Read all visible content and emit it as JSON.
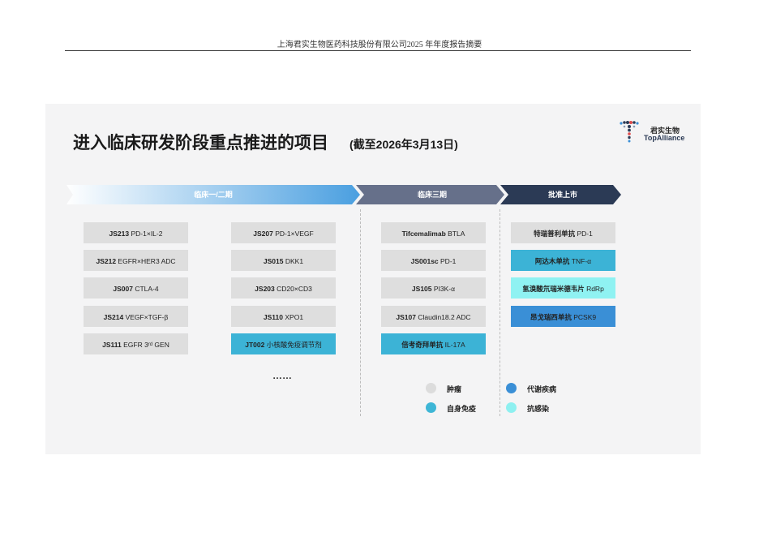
{
  "page_header": "上海君实生物医药科技股份有限公司2025 年年度报告摘要",
  "slide": {
    "title": "进入临床研发阶段重点推进的项目",
    "subtitle": "(截至2026年3月13日)",
    "logo": {
      "cn": "君实生物",
      "en": "TopAlliance"
    }
  },
  "phases": [
    {
      "label": "临床一/二期",
      "color": "#4a9fe0"
    },
    {
      "label": "临床三期",
      "color": "#66708a"
    },
    {
      "label": "批准上市",
      "color": "#2b3a55"
    }
  ],
  "columns": [
    {
      "items": [
        {
          "code": "JS213",
          "rest": " PD-1×IL-2",
          "category": "oncology"
        },
        {
          "code": "JS212",
          "rest": " EGFR×HER3 ADC",
          "category": "oncology"
        },
        {
          "code": "JS007",
          "rest": " CTLA-4",
          "category": "oncology"
        },
        {
          "code": "JS214",
          "rest": " VEGF×TGF-β",
          "category": "oncology"
        },
        {
          "code": "JS111",
          "rest": " EGFR 3ʳᵈ GEN",
          "category": "oncology"
        }
      ]
    },
    {
      "items": [
        {
          "code": "JS207",
          "rest": " PD-1×VEGF",
          "category": "oncology"
        },
        {
          "code": "JS015",
          "rest": " DKK1",
          "category": "oncology"
        },
        {
          "code": "JS203",
          "rest": " CD20×CD3",
          "category": "oncology"
        },
        {
          "code": "JS110",
          "rest": " XPO1",
          "category": "oncology"
        },
        {
          "code": "JT002",
          "rest": " 小核酸免疫调节剂",
          "category": "autoimmune"
        }
      ]
    },
    {
      "items": [
        {
          "code": "Tifcemalimab",
          "rest": " BTLA",
          "category": "oncology"
        },
        {
          "code": "JS001sc",
          "rest": " PD-1",
          "category": "oncology"
        },
        {
          "code": "JS105",
          "rest": " PI3K-α",
          "category": "oncology"
        },
        {
          "code": "JS107",
          "rest": " Claudin18.2 ADC",
          "category": "oncology"
        },
        {
          "code": "倍考奇拜单抗",
          "rest": " IL-17A",
          "category": "autoimmune"
        }
      ]
    },
    {
      "items": [
        {
          "code": "特瑞普利单抗",
          "rest": " PD-1",
          "category": "oncology"
        },
        {
          "code": "阿达木单抗",
          "rest": " TNF-α",
          "category": "autoimmune"
        },
        {
          "code": "氢溴酸氘瑞米德韦片",
          "rest": "  RdRp",
          "category": "anti_infection"
        },
        {
          "code": "昂戈瑞西单抗",
          "rest": " PCSK9",
          "category": "metabolic"
        }
      ]
    }
  ],
  "ellipsis": "……",
  "legend": [
    {
      "key": "oncology",
      "label": "肿瘤",
      "color": "#dcdcdc"
    },
    {
      "key": "metabolic",
      "label": "代谢疾病",
      "color": "#3a8fd6"
    },
    {
      "key": "autoimmune",
      "label": "自身免疫",
      "color": "#3eb6d6"
    },
    {
      "key": "anti_infection",
      "label": "抗感染",
      "color": "#8ef0f0"
    }
  ],
  "category_colors": {
    "oncology": "#dedede",
    "autoimmune": "#3cb3d6",
    "anti_infection": "#8ff2f2",
    "metabolic": "#3a8fd6"
  }
}
